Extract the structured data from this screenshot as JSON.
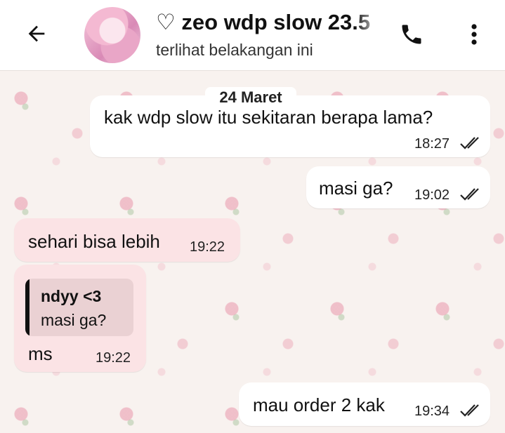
{
  "header": {
    "back_icon": "arrow-left-icon",
    "title": "♡ zeo wdp slow 23.5",
    "subtitle": "terlihat belakangan ini",
    "call_icon": "phone-icon",
    "menu_icon": "more-vertical-icon"
  },
  "date_separator": "24 Maret",
  "messages": [
    {
      "direction": "outgoing",
      "text": "kak wdp slow itu sekitaran berapa lama?",
      "time": "18:27",
      "status": "read"
    },
    {
      "direction": "outgoing",
      "text": "masi ga?",
      "time": "19:02",
      "status": "read"
    },
    {
      "direction": "incoming",
      "text": "sehari bisa lebih",
      "time": "19:22"
    },
    {
      "direction": "incoming",
      "reply_to": {
        "author": "ndyy <3",
        "text": "masi ga?"
      },
      "text": "ms",
      "time": "19:22"
    },
    {
      "direction": "outgoing",
      "text": "mau order 2 kak",
      "time": "19:34",
      "status": "read"
    }
  ],
  "colors": {
    "incoming_bubble": "#fbe3e5",
    "outgoing_bubble": "#ffffff",
    "quote_background": "#ead1d3",
    "wallpaper": "#f8f2ef"
  }
}
